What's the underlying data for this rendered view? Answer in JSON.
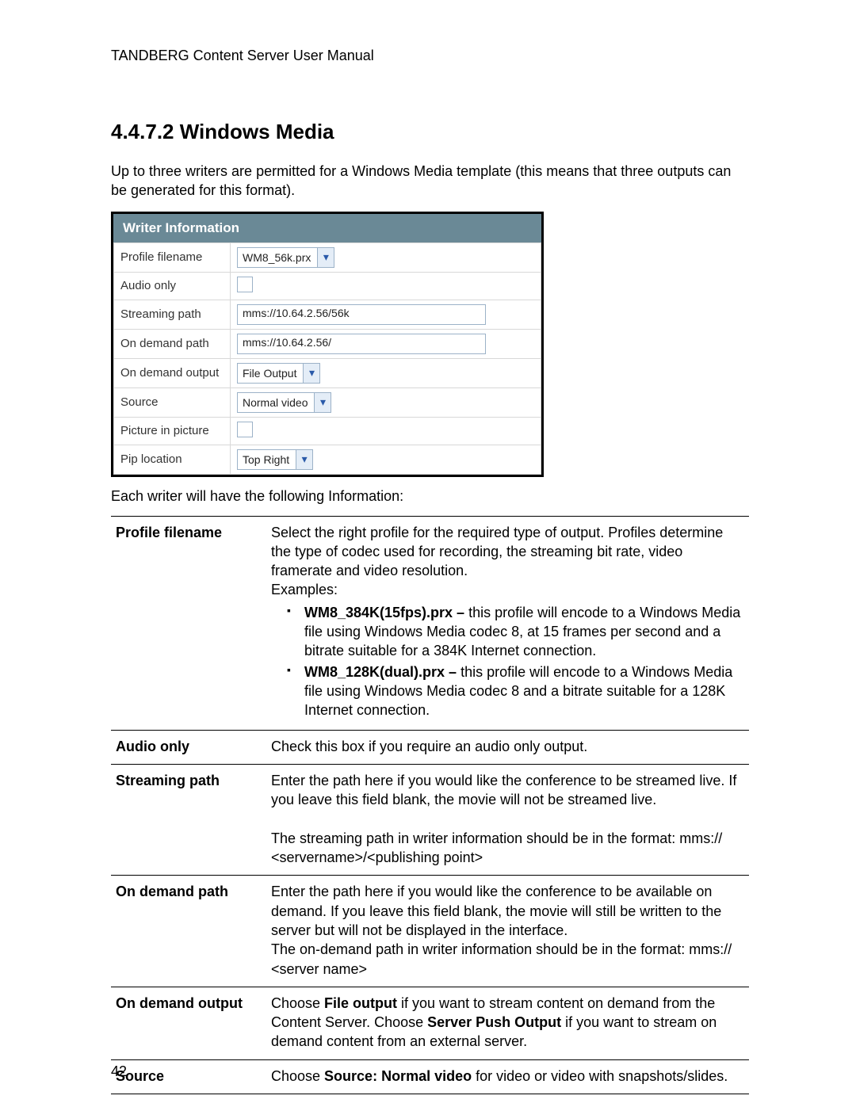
{
  "header": "TANDBERG Content Server User Manual",
  "section": {
    "number": "4.4.7.2",
    "title": "Windows Media",
    "full": "4.4.7.2 Windows Media"
  },
  "intro": "Up to three writers are permitted for a Windows Media template (this means that three outputs can be generated for this format).",
  "screenshot": {
    "title": "Writer Information",
    "rows": {
      "profile_filename": {
        "label": "Profile filename",
        "value": "WM8_56k.prx"
      },
      "audio_only": {
        "label": "Audio only",
        "checked": false
      },
      "streaming_path": {
        "label": "Streaming path",
        "value": "mms://10.64.2.56/56k"
      },
      "on_demand_path": {
        "label": "On demand path",
        "value": "mms://10.64.2.56/"
      },
      "on_demand_output": {
        "label": "On demand output",
        "value": "File Output"
      },
      "source": {
        "label": "Source",
        "value": "Normal video"
      },
      "picture_in_picture": {
        "label": "Picture in picture",
        "checked": false
      },
      "pip_location": {
        "label": "Pip location",
        "value": "Top Right"
      }
    }
  },
  "after_screenshot": "Each writer will have the following Information:",
  "defs": {
    "profile_filename": {
      "term": "Profile filename",
      "intro": "Select the right profile for the required type of output. Profiles determine the type of codec used for recording, the streaming bit rate, video framerate and video resolution.",
      "examples_label": "Examples:",
      "ex1_bold": "WM8_384K(15fps).prx – ",
      "ex1_rest": "this profile will encode to a Windows Media file using Windows Media codec 8, at 15 frames per second and a bitrate suitable for a 384K Internet connection.",
      "ex2_bold": "WM8_128K(dual).prx – ",
      "ex2_rest": "this profile will encode to a Windows Media file using Windows Media codec 8 and a bitrate suitable for a 128K Internet connection."
    },
    "audio_only": {
      "term": "Audio only",
      "text": "Check this box if you require an audio only output."
    },
    "streaming_path": {
      "term": "Streaming path",
      "p1": "Enter the path here if you would like the conference to be streamed live. If you leave this field blank, the movie will not be streamed live.",
      "p2": "The streaming path in writer information should be in the format: mms:// <servername>/<publishing point>"
    },
    "on_demand_path": {
      "term": "On demand path",
      "text": "Enter the path here if you would like the conference to be available on demand. If you leave this field blank, the movie will still be written to the server but will not be displayed in the interface.\nThe on-demand path in writer information should be in the format: mms:// <server name>"
    },
    "on_demand_output": {
      "term": "On demand output",
      "pre": "Choose ",
      "b1": "File output",
      "mid1": " if you want to stream content on demand from the Content Server. Choose ",
      "b2": "Server Push Output",
      "post": " if you want to stream on demand content from an external server."
    },
    "source": {
      "term": "Source",
      "pre": "Choose ",
      "b1": "Source: Normal video",
      "post": " for video or video with snapshots/slides."
    }
  },
  "page_number": "42"
}
